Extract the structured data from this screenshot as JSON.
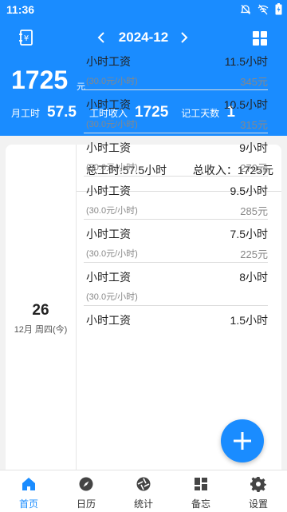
{
  "status": {
    "time": "11:36"
  },
  "header": {
    "month": "2024-12",
    "total": "1725",
    "total_unit": "元",
    "stats": [
      {
        "label": "月工时",
        "value": "57.5"
      },
      {
        "label": "工时收入",
        "value": "1725"
      },
      {
        "label": "记工天数",
        "value": "1"
      }
    ]
  },
  "day": {
    "date": "26",
    "sub": "12月 周四(今)",
    "summary_hours": "总工时:57.5小时",
    "summary_income": "总收入：1725元",
    "entries": [
      {
        "type": "小时工资",
        "hours": "11.5小时",
        "rate": "(30.0元/小时)",
        "amount": "345元"
      },
      {
        "type": "小时工资",
        "hours": "10.5小时",
        "rate": "(30.0元/小时)",
        "amount": "315元"
      },
      {
        "type": "小时工资",
        "hours": "9小时",
        "rate": "(30.0元/小时)",
        "amount": "270元"
      },
      {
        "type": "小时工资",
        "hours": "9.5小时",
        "rate": "(30.0元/小时)",
        "amount": "285元"
      },
      {
        "type": "小时工资",
        "hours": "7.5小时",
        "rate": "(30.0元/小时)",
        "amount": "225元"
      },
      {
        "type": "小时工资",
        "hours": "8小时",
        "rate": "(30.0元/小时)",
        "amount": ""
      },
      {
        "type": "小时工资",
        "hours": "1.5小时",
        "rate": "",
        "amount": ""
      }
    ]
  },
  "tabs": [
    {
      "label": "首页",
      "icon": "home-icon"
    },
    {
      "label": "日历",
      "icon": "compass-icon"
    },
    {
      "label": "统计",
      "icon": "aperture-icon"
    },
    {
      "label": "备忘",
      "icon": "memo-grid-icon"
    },
    {
      "label": "设置",
      "icon": "gear-icon"
    }
  ],
  "colors": {
    "primary": "#1a8cff",
    "background": "#f2f2f2"
  }
}
